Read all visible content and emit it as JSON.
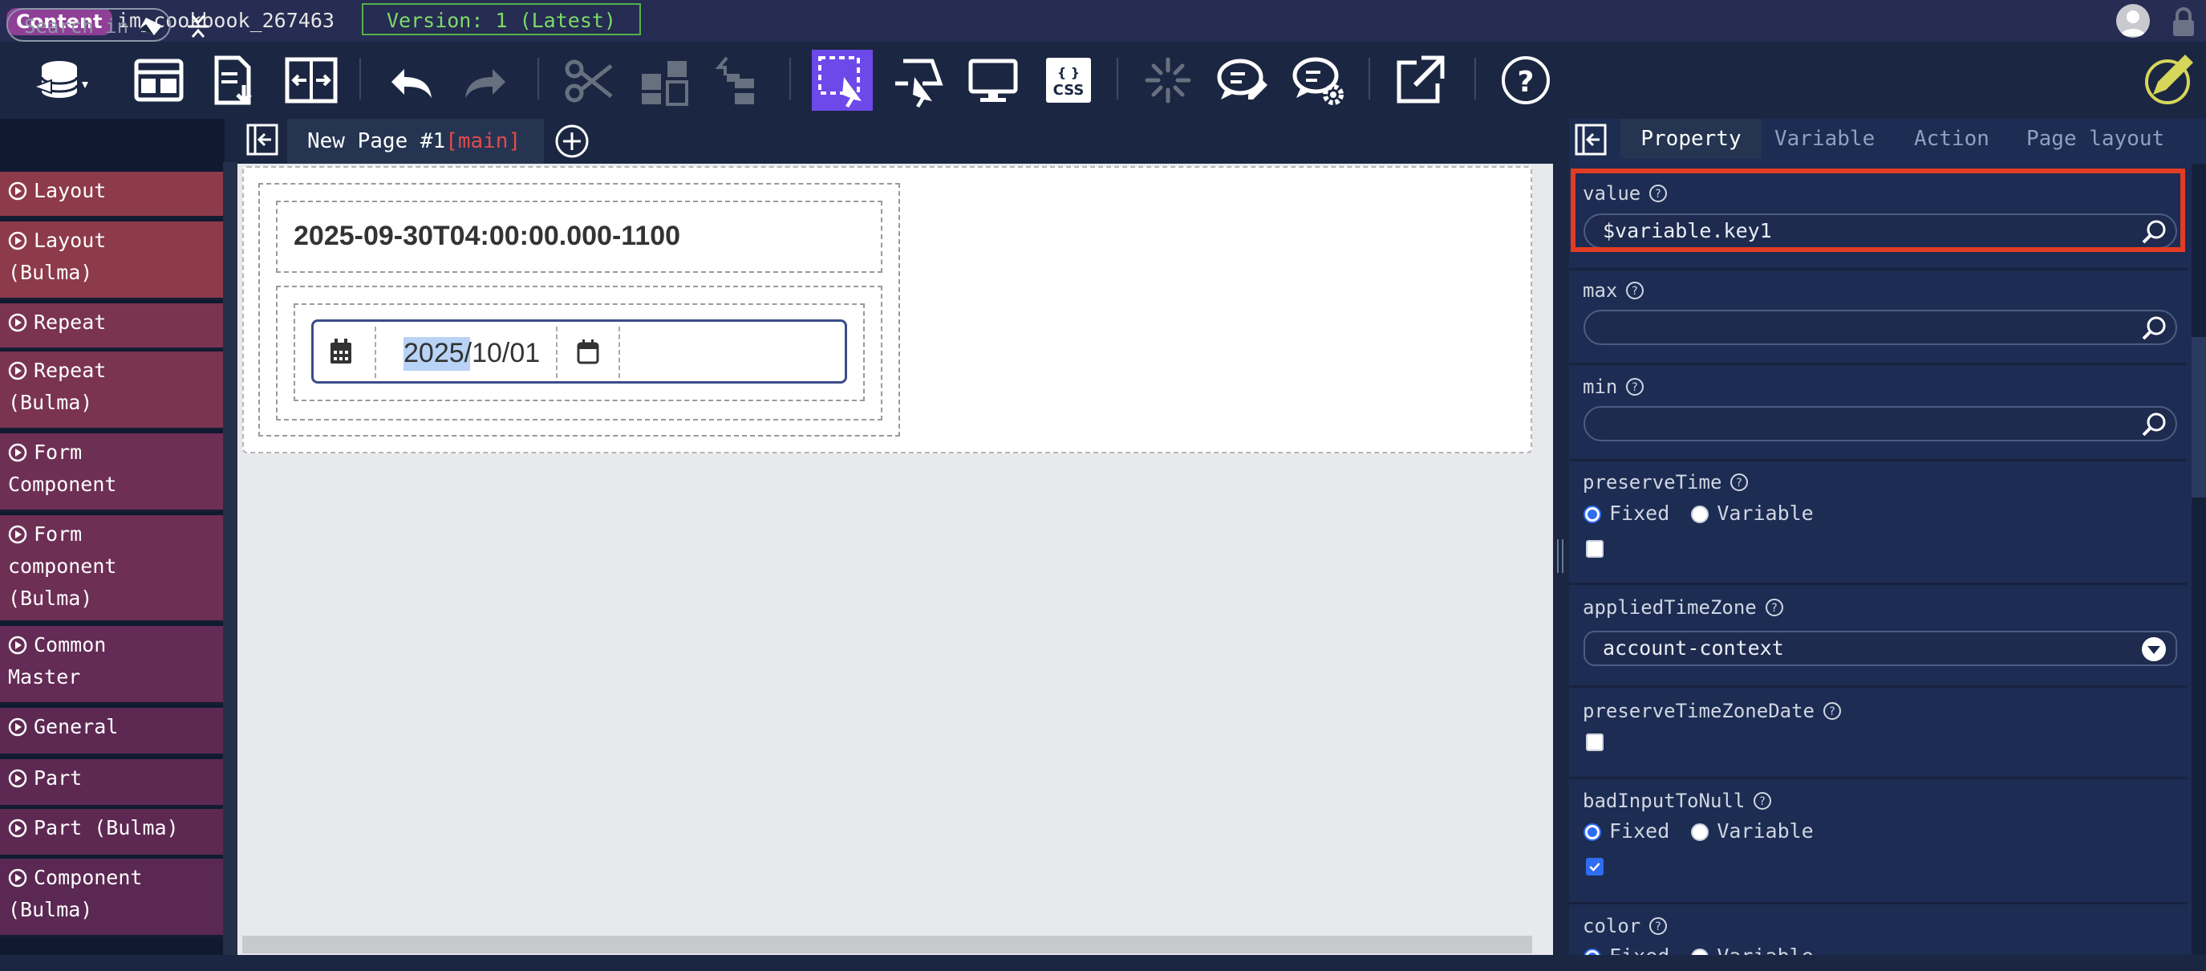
{
  "titlebar": {
    "badge": "Content",
    "name": "im_cookbook_267463",
    "version": "Version: 1 (Latest)"
  },
  "toolbar": {
    "icons": [
      "database-icon",
      "layout-icon",
      "export-icon",
      "split-icon",
      "undo-icon",
      "redo-icon",
      "cut-icon",
      "group-icon",
      "ungroup-icon",
      "select-icon",
      "pointer-icon",
      "preview-icon",
      "css-icon",
      "loading-icon",
      "comment-icon",
      "comment-settings-icon",
      "open-external-icon",
      "help-icon",
      "edit-icon"
    ],
    "css_label": "{ }\nCSS"
  },
  "sidebar": {
    "search_placeholder": "Search in",
    "categories": [
      {
        "label": "Layout",
        "color": "#8d3a4a"
      },
      {
        "label": "Layout\n(Bulma)",
        "color": "#8d3a4a"
      },
      {
        "label": "Repeat",
        "color": "#7a3450"
      },
      {
        "label": "Repeat\n(Bulma)",
        "color": "#7a3450"
      },
      {
        "label": "Form\nComponent",
        "color": "#6e2f55"
      },
      {
        "label": "Form\ncomponent\n(Bulma)",
        "color": "#6e2f55"
      },
      {
        "label": "Common\nMaster",
        "color": "#632b55"
      },
      {
        "label": "General",
        "color": "#5d2953"
      },
      {
        "label": "Part",
        "color": "#5d2953"
      },
      {
        "label": "Part (Bulma)",
        "color": "#5d2953"
      },
      {
        "label": "Component\n(Bulma)",
        "color": "#5a2852"
      }
    ]
  },
  "tabs": {
    "page_name": "New Page #1",
    "page_suffix": "[main]"
  },
  "canvas": {
    "datetime_text": "2025-09-30T04:00:00.000-1100",
    "date_year": "2025",
    "date_rest": "/10/01"
  },
  "panel": {
    "tabs": [
      "Property",
      "Variable",
      "Action",
      "Page layout"
    ],
    "props": {
      "value_label": "value",
      "value_input": "$variable.key1",
      "max_label": "max",
      "min_label": "min",
      "preserveTime_label": "preserveTime",
      "fixed": "Fixed",
      "variable": "Variable",
      "appliedTimeZone_label": "appliedTimeZone",
      "appliedTimeZone_value": "account-context",
      "preserveTimeZoneDate_label": "preserveTimeZoneDate",
      "badInputToNull_label": "badInputToNull",
      "color_label": "color"
    }
  },
  "colors": {
    "accent": "#6e49e9",
    "highlight": "#e23d24",
    "version_green": "#56b04a"
  }
}
